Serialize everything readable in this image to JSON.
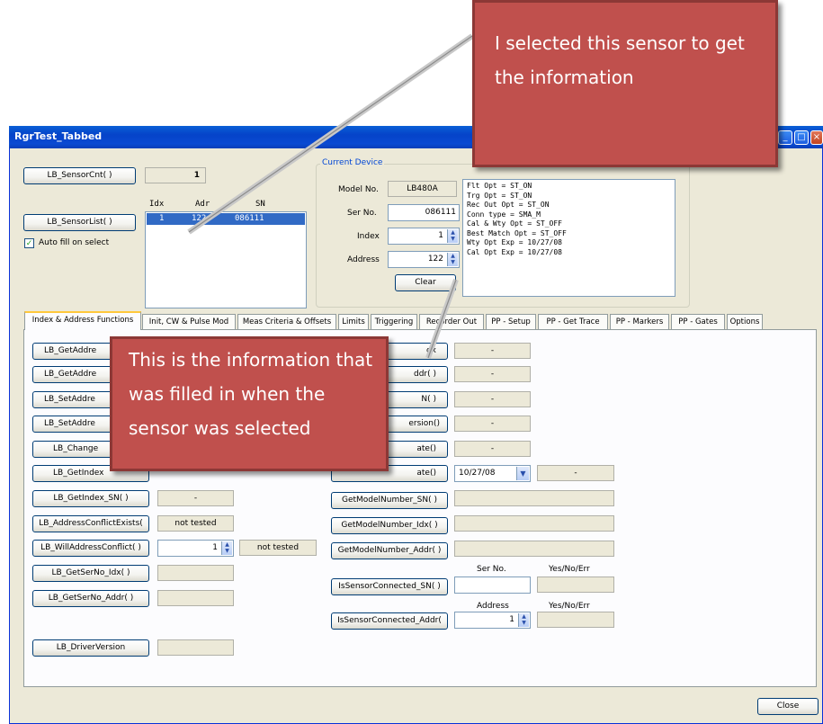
{
  "window": {
    "title": "RgrTest_Tabbed",
    "close_label": "Close"
  },
  "top": {
    "sensor_cnt_button": "LB_SensorCnt( )",
    "sensor_cnt_value": "1",
    "sensor_list_button": "LB_SensorList( )",
    "auto_fill_label": "Auto fill on select",
    "list_headers": [
      "Idx",
      "Adr",
      "SN"
    ],
    "list_row": [
      "1",
      "122",
      "086111"
    ]
  },
  "current_device": {
    "legend": "Current Device",
    "model_label": "Model No.",
    "model_value": "LB480A",
    "serno_label": "Ser No.",
    "serno_value": "086111",
    "index_label": "Index",
    "index_value": "1",
    "address_label": "Address",
    "address_value": "122",
    "clear_label": "Clear",
    "options_text": [
      "Flt Opt = ST_ON",
      "Trg Opt = ST_ON",
      "Rec Out Opt = ST_ON",
      "Conn type = SMA_M",
      "Cal & Wty Opt = ST_OFF",
      "Best Match Opt = ST_OFF",
      "Wty Opt Exp = 10/27/08",
      "Cal Opt Exp = 10/27/08"
    ]
  },
  "tabs": [
    "Index & Address Functions",
    "Init, CW & Pulse Mod",
    "Meas Criteria & Offsets",
    "Limits",
    "Triggering",
    "Recorder Out",
    "PP - Setup",
    "PP - Get Trace",
    "PP - Markers",
    "PP - Gates",
    "Options"
  ],
  "left_col": {
    "b1": "LB_GetAddre",
    "b2": "LB_GetAddre",
    "b3": "LB_SetAddre",
    "b4": "LB_SetAddre",
    "b5": "LB_Change",
    "b6": "LB_GetIndex",
    "b7": "LB_GetIndex_SN( )",
    "b7_value": "-",
    "b8": "LB_AddressConflictExists(",
    "b8_value": "not tested",
    "b9": "LB_WillAddressConflict( )",
    "b9_spin": "1",
    "b9_value": "not tested",
    "b10": "LB_GetSerNo_Idx( )",
    "b11": "LB_GetSerNo_Addr( )",
    "b12": "LB_DriverVersion"
  },
  "right_col": {
    "r1": "dx",
    "r1_value": "-",
    "r2": "ddr( )",
    "r2_value": "-",
    "r3": "N( )",
    "r3_value": "-",
    "r4": "ersion()",
    "r4_value": "-",
    "r5": "ate()",
    "r5_value": "-",
    "r6": "ate()",
    "r6_date": "10/27/08",
    "r6_value": "-",
    "r7": "GetModelNumber_SN( )",
    "r8": "GetModelNumber_Idx( )",
    "r9": "GetModelNumber_Addr( )",
    "serno_col": "Ser No.",
    "yne_col": "Yes/No/Err",
    "r10": "IsSensorConnected_SN( )",
    "address_col": "Address",
    "yne_col2": "Yes/No/Err",
    "r11": "IsSensorConnected_Addr(",
    "r11_spin": "1"
  },
  "callouts": {
    "top": "I selected this sensor to get the information",
    "middle": "This is the information that was filled in when the sensor was selected"
  }
}
